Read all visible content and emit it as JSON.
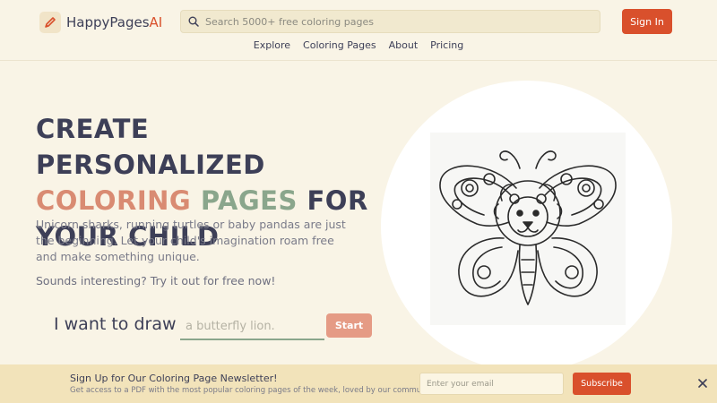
{
  "header": {
    "brand": "HappyPages",
    "brand_suffix": "AI",
    "search_placeholder": "Search 5000+ free coloring pages",
    "sign_in": "Sign In",
    "nav": [
      "Explore",
      "Coloring Pages",
      "About",
      "Pricing"
    ]
  },
  "hero": {
    "headline_line1": "Create personalized",
    "headline_word_coloring": "coloring",
    "headline_word_pages": "pages",
    "headline_word_for": "for",
    "headline_line3": "your child",
    "description": "Unicorn sharks, running turtles or baby pandas are just the beginning. Let your child's imagination roam free and make something unique.",
    "tagline": "Sounds interesting? Try it out for free now!",
    "draw_label": "I want to draw",
    "draw_placeholder": "a butterfly lion.",
    "start_button": "Start",
    "image_icon": "butterfly-lion-illustration"
  },
  "newsletter": {
    "title": "Sign Up for Our Coloring Page Newsletter!",
    "subtitle": "Get access to a PDF with the most popular coloring pages of the week, loved by our community.",
    "email_placeholder": "Enter your email",
    "subscribe": "Subscribe"
  },
  "colors": {
    "background": "#f9f4e6",
    "accent": "#d9502c",
    "salmon": "#d98b72",
    "sage": "#8aa68c",
    "navy": "#3d3f57",
    "newsletter_bg": "#f2e3ba"
  }
}
